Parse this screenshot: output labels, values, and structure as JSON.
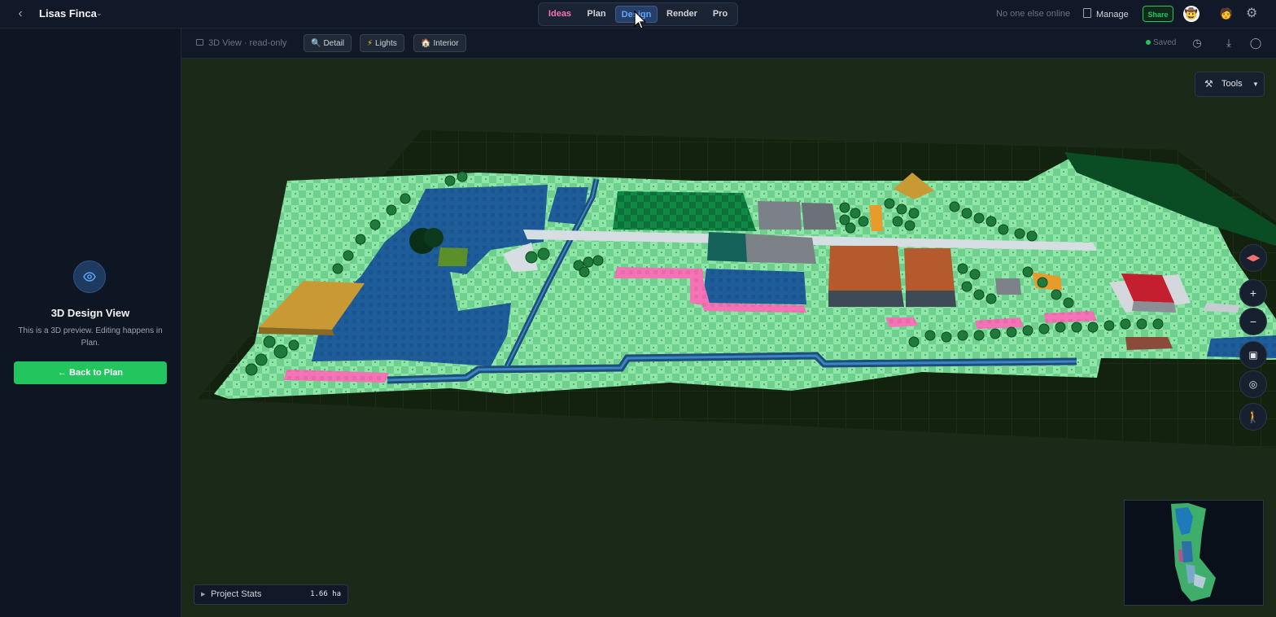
{
  "header": {
    "project_name": "Lisas Finca",
    "mode_tabs": [
      {
        "label": "Ideas"
      },
      {
        "label": "Plan"
      },
      {
        "label": "Design",
        "active": true
      },
      {
        "label": "Render"
      },
      {
        "label": "Pro"
      }
    ],
    "presence": "No one else online",
    "manage_label": "Manage",
    "share_label": "Share"
  },
  "sidebar": {
    "title": "3D Design View",
    "description": "This is a 3D preview. Editing happens in Plan.",
    "back_button": "← Back to Plan"
  },
  "view_toolbar": {
    "mode_label": "3D View · read-only",
    "chips": [
      {
        "icon": "magnifier-icon",
        "label": "Detail"
      },
      {
        "icon": "lightning-icon",
        "label": "Lights"
      },
      {
        "icon": "house-icon",
        "label": "Interior"
      }
    ],
    "saved_label": "Saved"
  },
  "viewport": {
    "tools_label": "Tools",
    "stats_label": "Project Stats",
    "stats_value": "1.66 ha"
  },
  "colors": {
    "accent_green": "#22c55e",
    "active_tab_blue": "#60a5fa",
    "ideas_pink": "#f472b6"
  }
}
